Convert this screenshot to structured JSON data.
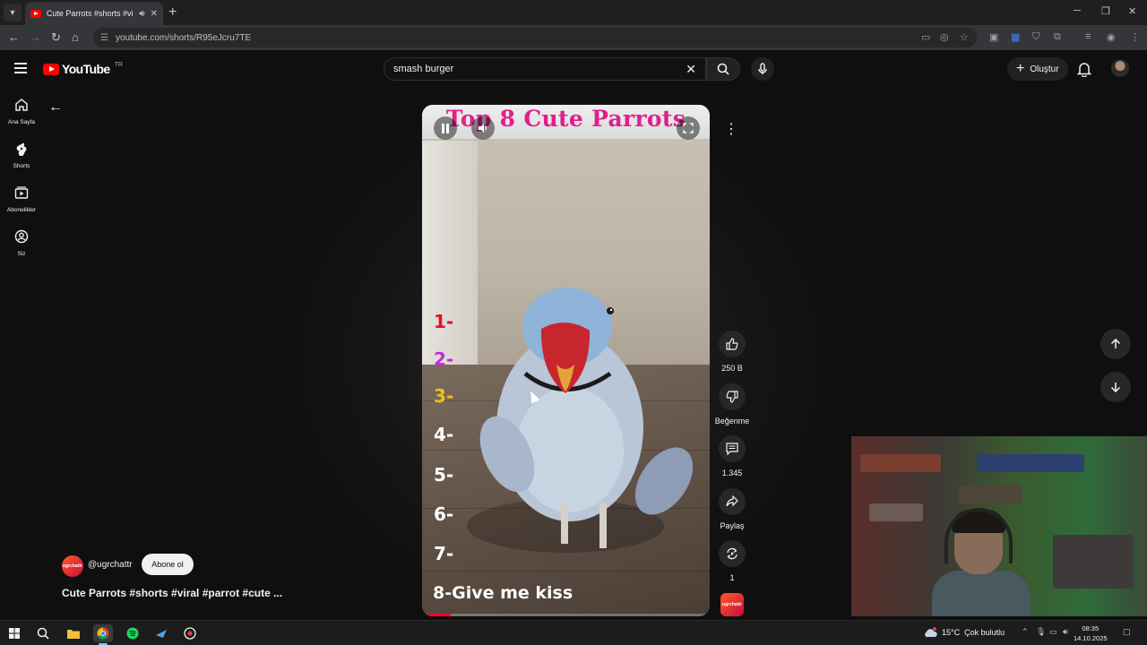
{
  "browser": {
    "tab_title": "Cute Parrots #shorts #viral #parrot #cute - YouTube",
    "url": "youtube.com/shorts/R95eJcru7TE",
    "window_controls": {
      "minimize": "─",
      "restore": "❐",
      "close": "✕"
    }
  },
  "header": {
    "logo_text": "YouTube",
    "country_code": "TR",
    "search_query": "smash burger",
    "create_label": "Oluştur"
  },
  "sidebar": {
    "items": [
      {
        "label": "Ana Sayfa",
        "icon": "home-icon"
      },
      {
        "label": "Shorts",
        "icon": "shorts-icon"
      },
      {
        "label": "Abonelikler",
        "icon": "subscriptions-icon"
      },
      {
        "label": "Siz",
        "icon": "you-icon"
      }
    ]
  },
  "video": {
    "overlay_title": "Top 8 Cute Parrots",
    "ranks": [
      {
        "text": "1-",
        "color": "#e0102a"
      },
      {
        "text": "2-",
        "color": "#c02be0"
      },
      {
        "text": "3-",
        "color": "#e9c21a"
      },
      {
        "text": "4-",
        "color": "#ffffff"
      },
      {
        "text": "5-",
        "color": "#ffffff"
      },
      {
        "text": "6-",
        "color": "#ffffff"
      },
      {
        "text": "7-",
        "color": "#ffffff"
      }
    ],
    "caption": "8-Give me kiss",
    "progress_fraction": 0.1
  },
  "actions": {
    "like_count": "250 B",
    "dislike_label": "Beğenme",
    "comment_count": "1.345",
    "share_label": "Paylaş",
    "remix_count": "1"
  },
  "channel": {
    "handle": "@ugrchattr",
    "avatar_text": "ugrchattr",
    "subscribe_label": "Abone ol",
    "video_title": "Cute Parrots #shorts #viral #parrot #cute ..."
  },
  "taskbar": {
    "weather_temp": "15°C",
    "weather_desc": "Çok bulutlu",
    "time": "08:35",
    "date": "14.10.2025"
  },
  "colors": {
    "accent_red": "#ff0000",
    "title_pink": "#e01f8a",
    "background": "#0f0f0f"
  }
}
